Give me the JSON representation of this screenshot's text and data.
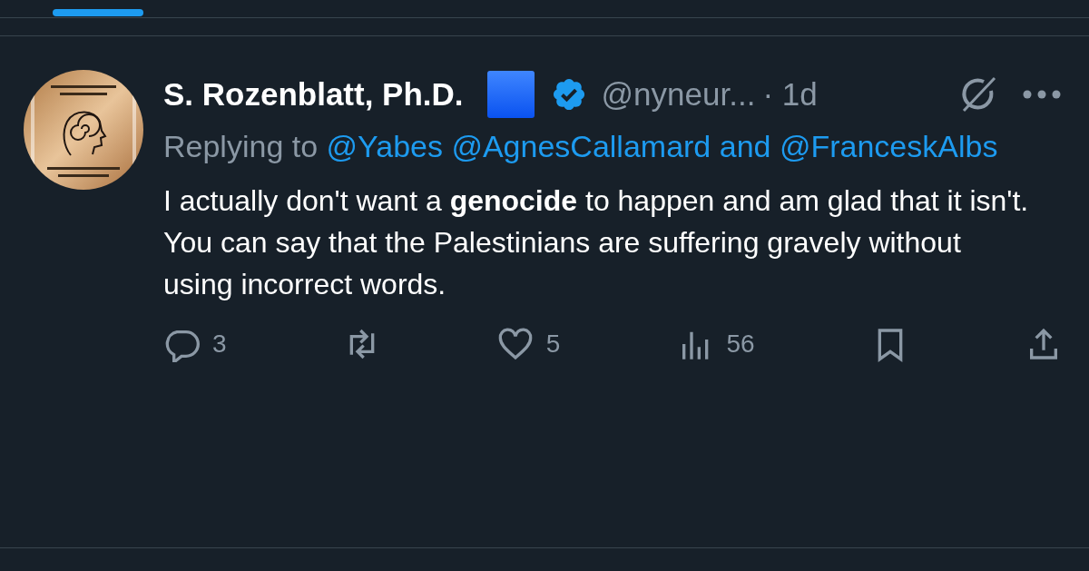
{
  "tweet": {
    "author_name": "S. Rozenblatt, Ph.D.",
    "handle": "@nyneur...",
    "time": "· 1d",
    "reply": {
      "prefix": "Replying to",
      "mentions": [
        "@Yabes",
        "@AgnesCallamard"
      ],
      "conjunction": "and",
      "last": "@FranceskAlbs"
    },
    "text": "I actually don't want a **genocide** to happen and am glad that it isn't. You can say that the Palestinians are suffering gravely without using incorrect words.",
    "actions": [
      {
        "kind": "reply",
        "count": "3"
      },
      {
        "kind": "retweet"
      },
      {
        "kind": "like",
        "count": "5"
      },
      {
        "kind": "views",
        "count": "56"
      },
      {
        "kind": "bookmark"
      },
      {
        "kind": "share"
      }
    ]
  }
}
